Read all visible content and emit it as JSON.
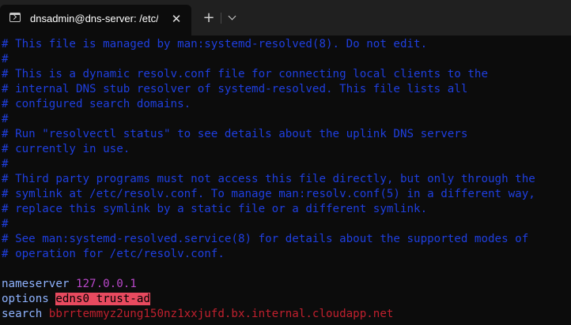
{
  "tab": {
    "icon": "terminal-icon",
    "title": "dnsadmin@dns-server: /etc/bi",
    "close_label": "✕",
    "new_tab_label": "+",
    "dropdown_icon": "chevron-down-icon"
  },
  "terminal": {
    "comments": [
      "# This file is managed by man:systemd-resolved(8). Do not edit.",
      "#",
      "# This is a dynamic resolv.conf file for connecting local clients to the",
      "# internal DNS stub resolver of systemd-resolved. This file lists all",
      "# configured search domains.",
      "#",
      "# Run \"resolvectl status\" to see details about the uplink DNS servers",
      "# currently in use.",
      "#",
      "# Third party programs must not access this file directly, but only through the",
      "# symlink at /etc/resolv.conf. To manage man:resolv.conf(5) in a different way,",
      "# replace this symlink by a static file or a different symlink.",
      "#",
      "# See man:systemd-resolved.service(8) for details about the supported modes of",
      "# operation for /etc/resolv.conf."
    ],
    "nameserver": {
      "keyword": "nameserver",
      "value": "127.0.0.1"
    },
    "options": {
      "keyword": "options",
      "value": "edns0 trust-ad"
    },
    "search": {
      "keyword": "search",
      "value": "bbrrtemmyz2ung150nz1xxjufd.bx.internal.cloudapp.net"
    }
  },
  "colors": {
    "background": "#0c0c0c",
    "comment": "#1f3fe0",
    "keyword": "#8fb3ff",
    "number": "#b847c9",
    "highlight_bg": "#e84a5f",
    "search_value": "#c0202e"
  }
}
